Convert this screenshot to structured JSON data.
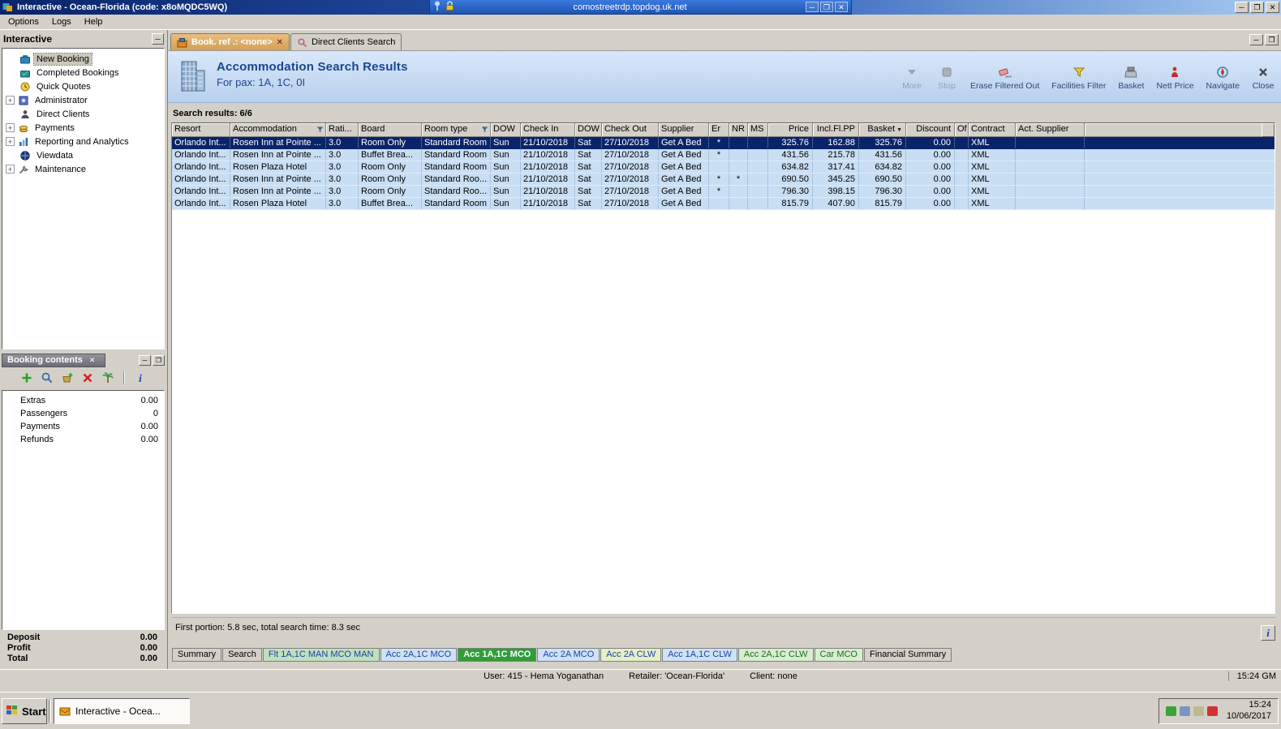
{
  "titlebar": {
    "app_title": "Interactive - Ocean-Florida (code: x8oMQDC5WQ)",
    "rdp_host": "comostreetrdp.topdog.uk.net",
    "window_buttons": [
      "minimize",
      "restore",
      "close"
    ]
  },
  "menubar": {
    "items": [
      "Options",
      "Logs",
      "Help"
    ]
  },
  "sidebar": {
    "title": "Interactive",
    "items": [
      {
        "label": "New Booking",
        "icon": "booking-icon",
        "selected": true,
        "expand": false
      },
      {
        "label": "Completed Bookings",
        "icon": "completed-icon",
        "expand": false
      },
      {
        "label": "Quick Quotes",
        "icon": "quotes-icon",
        "expand": false
      },
      {
        "label": "Administrator",
        "icon": "admin-icon",
        "expand": true
      },
      {
        "label": "Direct Clients",
        "icon": "clients-icon",
        "expand": false
      },
      {
        "label": "Payments",
        "icon": "payments-icon",
        "expand": true
      },
      {
        "label": "Reporting and Analytics",
        "icon": "reporting-icon",
        "expand": true
      },
      {
        "label": "Viewdata",
        "icon": "viewdata-icon",
        "expand": false
      },
      {
        "label": "Maintenance",
        "icon": "maintenance-icon",
        "expand": true
      }
    ]
  },
  "booking_contents": {
    "title": "Booking contents",
    "toolbar": [
      "add-icon",
      "search-person-icon",
      "basket-add-icon",
      "delete-icon",
      "palm-icon",
      "info-icon"
    ],
    "rows": [
      {
        "label": "Extras",
        "value": "0.00"
      },
      {
        "label": "Passengers",
        "value": "0"
      },
      {
        "label": "Payments",
        "value": "0.00"
      },
      {
        "label": "Refunds",
        "value": "0.00"
      }
    ],
    "totals": [
      {
        "label": "Deposit",
        "value": "0.00"
      },
      {
        "label": "Profit",
        "value": "0.00"
      },
      {
        "label": "Total",
        "value": "0.00"
      }
    ]
  },
  "main": {
    "tabs": [
      {
        "label": "Book. ref .: <none>",
        "active": true,
        "closable": true,
        "icon": "booking-tab-icon"
      },
      {
        "label": "Direct Clients Search",
        "active": false,
        "closable": false,
        "icon": "search-tab-icon"
      }
    ],
    "header": {
      "title": "Accommodation Search Results",
      "subtitle": "For pax: 1A, 1C, 0I"
    },
    "toolbar": [
      {
        "label": "More",
        "icon": "more-icon",
        "disabled": true
      },
      {
        "label": "Stop",
        "icon": "stop-icon",
        "disabled": true
      },
      {
        "label": "Erase Filtered Out",
        "icon": "erase-icon",
        "disabled": false
      },
      {
        "label": "Facilities Filter",
        "icon": "filter-icon",
        "disabled": false
      },
      {
        "label": "Basket",
        "icon": "basket-icon",
        "disabled": false
      },
      {
        "label": "Nett Price",
        "icon": "nett-price-icon",
        "disabled": false
      },
      {
        "label": "Navigate",
        "icon": "navigate-icon",
        "disabled": false
      },
      {
        "label": "Close",
        "icon": "close-icon",
        "disabled": false
      }
    ],
    "results_label": "Search results: 6/6",
    "grid": {
      "columns": [
        {
          "label": "Resort"
        },
        {
          "label": "Accommodation",
          "filter": true
        },
        {
          "label": "Rati..."
        },
        {
          "label": "Board"
        },
        {
          "label": "Room type",
          "filter": true
        },
        {
          "label": "DOW"
        },
        {
          "label": "Check In"
        },
        {
          "label": "DOW"
        },
        {
          "label": "Check Out"
        },
        {
          "label": "Supplier"
        },
        {
          "label": "Er"
        },
        {
          "label": "NR"
        },
        {
          "label": "MS"
        },
        {
          "label": "Price",
          "numeric": true
        },
        {
          "label": "Incl.Fl.PP",
          "numeric": true
        },
        {
          "label": "Basket",
          "numeric": true,
          "sort": "desc"
        },
        {
          "label": "Discount",
          "numeric": true
        },
        {
          "label": "Of"
        },
        {
          "label": "Contract"
        },
        {
          "label": "Act. Supplier"
        }
      ],
      "rows": [
        {
          "selected": true,
          "cells": [
            "Orlando Int...",
            "Rosen Inn at Pointe ...",
            "3.0",
            "Room Only",
            "Standard Room",
            "Sun",
            "21/10/2018",
            "Sat",
            "27/10/2018",
            "Get A Bed",
            "*",
            "",
            "",
            "325.76",
            "162.88",
            "325.76",
            "0.00",
            "",
            "XML",
            ""
          ]
        },
        {
          "selected": false,
          "cells": [
            "Orlando Int...",
            "Rosen Inn at Pointe ...",
            "3.0",
            "Buffet Brea...",
            "Standard Room",
            "Sun",
            "21/10/2018",
            "Sat",
            "27/10/2018",
            "Get A Bed",
            "*",
            "",
            "",
            "431.56",
            "215.78",
            "431.56",
            "0.00",
            "",
            "XML",
            ""
          ]
        },
        {
          "selected": false,
          "cells": [
            "Orlando Int...",
            "Rosen Plaza Hotel",
            "3.0",
            "Room Only",
            "Standard Room",
            "Sun",
            "21/10/2018",
            "Sat",
            "27/10/2018",
            "Get A Bed",
            "",
            "",
            "",
            "634.82",
            "317.41",
            "634.82",
            "0.00",
            "",
            "XML",
            ""
          ]
        },
        {
          "selected": false,
          "cells": [
            "Orlando Int...",
            "Rosen Inn at Pointe ...",
            "3.0",
            "Room Only",
            "Standard Roo...",
            "Sun",
            "21/10/2018",
            "Sat",
            "27/10/2018",
            "Get A Bed",
            "*",
            "*",
            "",
            "690.50",
            "345.25",
            "690.50",
            "0.00",
            "",
            "XML",
            ""
          ]
        },
        {
          "selected": false,
          "cells": [
            "Orlando Int...",
            "Rosen Inn at Pointe ...",
            "3.0",
            "Room Only",
            "Standard Roo...",
            "Sun",
            "21/10/2018",
            "Sat",
            "27/10/2018",
            "Get A Bed",
            "*",
            "",
            "",
            "796.30",
            "398.15",
            "796.30",
            "0.00",
            "",
            "XML",
            ""
          ]
        },
        {
          "selected": false,
          "cells": [
            "Orlando Int...",
            "Rosen Plaza Hotel",
            "3.0",
            "Buffet Brea...",
            "Standard Room",
            "Sun",
            "21/10/2018",
            "Sat",
            "27/10/2018",
            "Get A Bed",
            "",
            "",
            "",
            "815.79",
            "407.90",
            "815.79",
            "0.00",
            "",
            "XML",
            ""
          ]
        }
      ]
    },
    "status_line": "First portion: 5.8 sec, total search time: 8.3 sec",
    "bottom_tabs": [
      {
        "label": "Summary",
        "fg": "#000000",
        "bg": "#d4d0c8"
      },
      {
        "label": "Search",
        "fg": "#000000",
        "bg": "#d4d0c8"
      },
      {
        "label": "Flt 1A,1C MAN MCO MAN",
        "fg": "#1f3fa0",
        "bg": "#bfe0bf"
      },
      {
        "label": "Acc 2A,1C MCO",
        "fg": "#1f3fa0",
        "bg": "#cfe2f5"
      },
      {
        "label": "Acc 1A,1C MCO",
        "fg": "#ffffff",
        "bg": "#2f9e38",
        "active": true
      },
      {
        "label": "Acc 2A MCO",
        "fg": "#1f3fa0",
        "bg": "#cfe2f5"
      },
      {
        "label": "Acc 2A CLW",
        "fg": "#1f3fa0",
        "bg": "#e6efc6"
      },
      {
        "label": "Acc 1A,1C CLW",
        "fg": "#1f3fa0",
        "bg": "#cfe2f5"
      },
      {
        "label": "Acc 2A,1C CLW",
        "fg": "#1f6a1f",
        "bg": "#d9edcf"
      },
      {
        "label": "Car MCO",
        "fg": "#1f6a1f",
        "bg": "#d9edcf"
      },
      {
        "label": "Financial Summary",
        "fg": "#000000",
        "bg": "#d4d0c8"
      }
    ]
  },
  "statusbar": {
    "user": "User: 415 - Hema Yoganathan",
    "retailer": "Retailer: 'Ocean-Florida'",
    "client": "Client: none",
    "time": "15:24 GM"
  },
  "taskbar": {
    "start_label": "Start",
    "task_label": "Interactive - Ocea...",
    "tray_icons": [
      {
        "name": "status-green-icon",
        "color": "#3aa43a"
      },
      {
        "name": "display-icon",
        "color": "#7a96c0"
      },
      {
        "name": "mail-icon",
        "color": "#c0b890"
      },
      {
        "name": "alert-red-icon",
        "color": "#cc3434"
      }
    ],
    "tray_time": "15:24",
    "tray_date": "10/06/2017"
  }
}
